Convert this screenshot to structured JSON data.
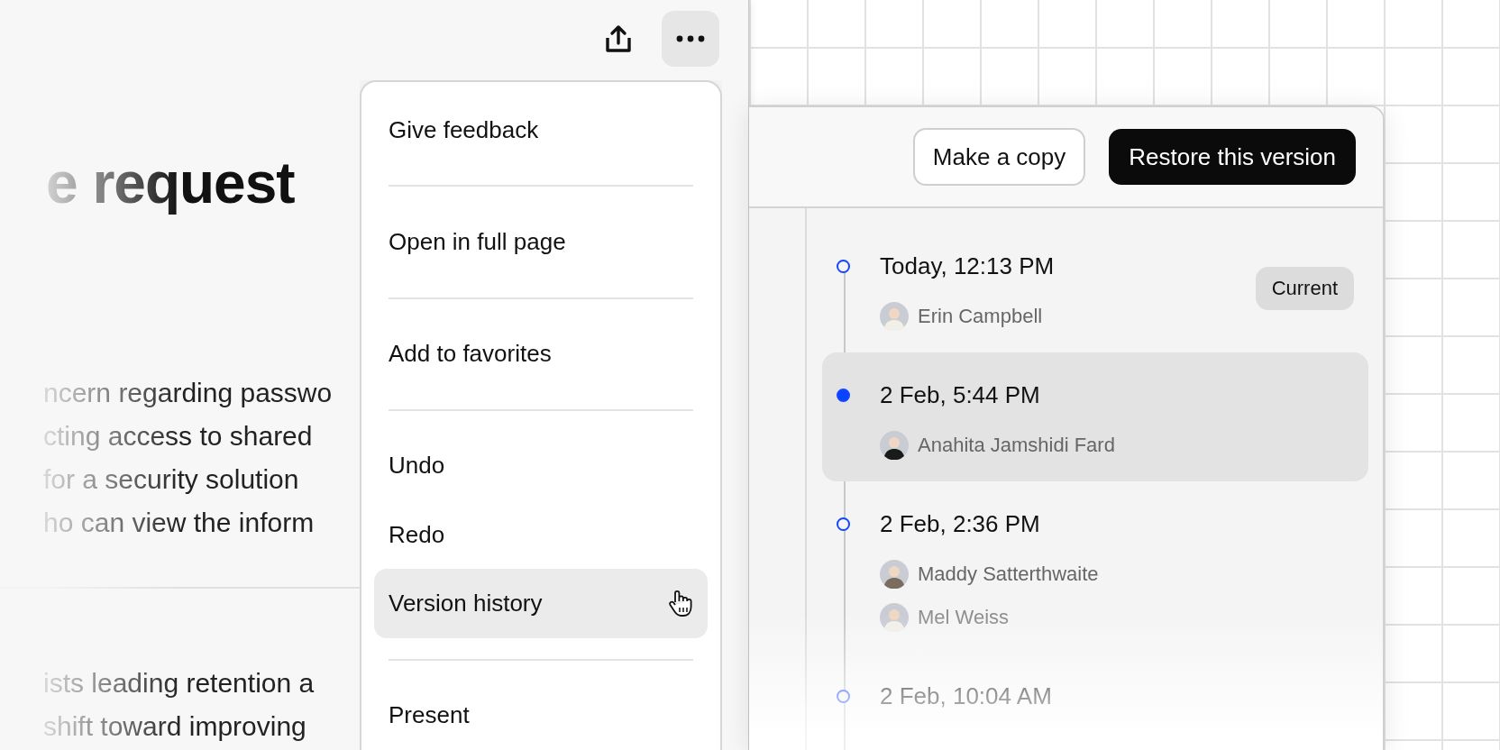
{
  "toolbar": {
    "more_pressed": true
  },
  "document": {
    "title": "e request",
    "paragraphs": [
      [
        "ncern regarding passwo",
        "cting access to shared",
        "for a security solution",
        "ho can view the inform"
      ],
      [
        "ists leading retention a",
        "shift toward improving"
      ]
    ]
  },
  "menu": {
    "items": [
      {
        "label": "Give feedback",
        "selected": false,
        "divider_after": true
      },
      {
        "label": "Open in full page",
        "selected": false,
        "divider_after": true
      },
      {
        "label": "Add to favorites",
        "selected": false,
        "divider_after": true
      },
      {
        "label": "Undo",
        "selected": false,
        "divider_after": false
      },
      {
        "label": "Redo",
        "selected": false,
        "divider_after": false
      },
      {
        "label": "Version history",
        "selected": true,
        "divider_after": true
      },
      {
        "label": "Present",
        "selected": false,
        "divider_after": false
      }
    ]
  },
  "version_history": {
    "actions": [
      {
        "label": "Make a copy",
        "kind": "secondary"
      },
      {
        "label": "Restore this version",
        "kind": "primary"
      }
    ],
    "versions": [
      {
        "time": "Today, 12:13 PM",
        "badge": "Current",
        "selected": false,
        "authors": [
          "Erin Campbell"
        ]
      },
      {
        "time": "2 Feb, 5:44 PM",
        "selected": true,
        "authors": [
          "Anahita Jamshidi Fard"
        ]
      },
      {
        "time": "2 Feb, 2:36 PM",
        "selected": false,
        "authors": [
          "Maddy Satterthwaite",
          "Mel Weiss"
        ]
      },
      {
        "time": "2 Feb, 10:04 AM",
        "selected": false
      }
    ]
  }
}
